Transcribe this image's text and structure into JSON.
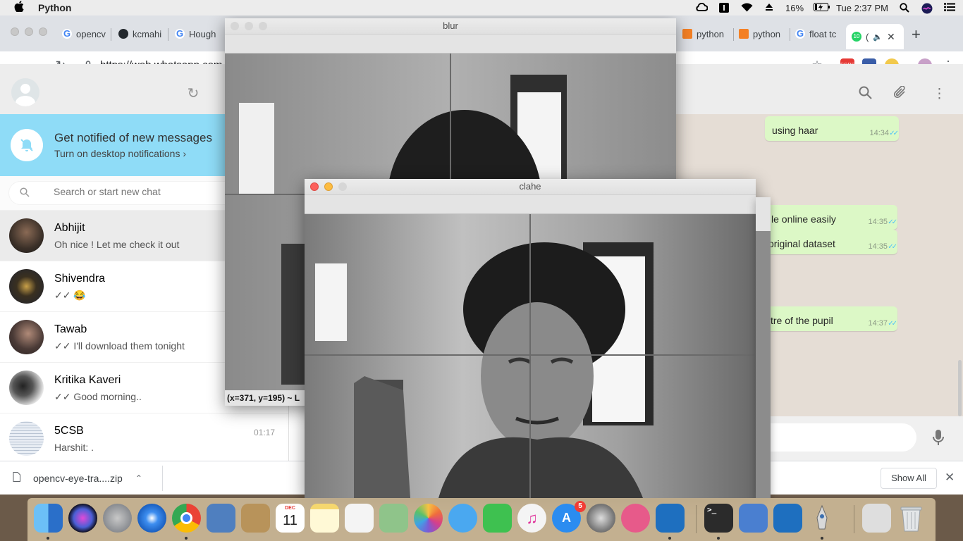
{
  "menubar": {
    "apple": "",
    "app_name": "Python",
    "battery": "16%",
    "clock": "Tue 2:37 PM"
  },
  "tabs": [
    {
      "label": "opencv",
      "icon": "google-icon",
      "color": "#4285f4"
    },
    {
      "label": "kcmahi",
      "icon": "github-icon",
      "color": "#24292e"
    },
    {
      "label": "Hough",
      "icon": "google-icon",
      "color": "#4285f4"
    },
    {
      "label": "python",
      "icon": "stackoverflow-icon",
      "color": "#f48024"
    },
    {
      "label": "python",
      "icon": "stackoverflow-icon",
      "color": "#f48024"
    },
    {
      "label": "float tc",
      "icon": "google-icon",
      "color": "#4285f4"
    },
    {
      "label": "(",
      "icon": "whatsapp-icon",
      "color": "#25d366"
    }
  ],
  "active_tab_favicon_text": "10",
  "url": "https://web.whatsapp.com",
  "extensions": [
    {
      "label": "CORS",
      "color": "#e53935"
    },
    {
      "label": "",
      "color": "#3a5da8"
    },
    {
      "label": "",
      "color": "#f2c94c"
    },
    {
      "label": "",
      "color": "#c8a0c8"
    }
  ],
  "notification": {
    "title": "Get notified of new messages",
    "subtitle": "Turn on desktop notifications ›"
  },
  "search": {
    "placeholder": "Search or start new chat"
  },
  "chats": [
    {
      "name": "Abhijit",
      "message": "Oh nice ! Let me check it out",
      "time": "",
      "color": "#3b3028"
    },
    {
      "name": "Shivendra",
      "message": "✓✓ 😂",
      "time": "",
      "color": "#1f2330"
    },
    {
      "name": "Tawab",
      "message": "✓✓ I'll download them tonight",
      "time": "",
      "color": "#4a3a36"
    },
    {
      "name": "Kritika Kaveri",
      "message": "✓✓ Good morning..",
      "time": "",
      "color": "#d9d9d9"
    },
    {
      "name": "5CSB",
      "message": "Harshit: .",
      "time": "01:17",
      "color": "#e8edf4"
    }
  ],
  "messages": [
    {
      "text": "using haar",
      "time": "14:34"
    },
    {
      "text": "le online easily",
      "time": "14:35"
    },
    {
      "text": "original dataset",
      "time": "14:35"
    },
    {
      "text": "tre of the pupil",
      "time": "14:37"
    }
  ],
  "download": {
    "filename": "opencv-eye-tra....zip",
    "show_all": "Show All"
  },
  "cv_blur": {
    "title": "blur",
    "status": "(x=371, y=195) ~ L"
  },
  "cv_clahe": {
    "title": "clahe"
  },
  "dock": [
    {
      "name": "finder",
      "color": "#3a8ee6"
    },
    {
      "name": "siri",
      "color": "#2b2b50"
    },
    {
      "name": "launchpad",
      "color": "#8a8f98"
    },
    {
      "name": "safari",
      "color": "#2a7be4"
    },
    {
      "name": "chrome",
      "color": "#e8e8e8"
    },
    {
      "name": "preview",
      "color": "#4f7fbf"
    },
    {
      "name": "contacts",
      "color": "#b8935a"
    },
    {
      "name": "calendar",
      "color": "#ffffff"
    },
    {
      "name": "notes",
      "color": "#f5d76e"
    },
    {
      "name": "reminders",
      "color": "#f4f4f4"
    },
    {
      "name": "maps",
      "color": "#8fc48a"
    },
    {
      "name": "photos",
      "color": "#ffffff"
    },
    {
      "name": "messages",
      "color": "#4aa8f0"
    },
    {
      "name": "facetime",
      "color": "#3ec150"
    },
    {
      "name": "itunes",
      "color": "#f4f4f4"
    },
    {
      "name": "app-store",
      "color": "#2b8cf0"
    },
    {
      "name": "system-preferences",
      "color": "#7d7d7d"
    },
    {
      "name": "archive-utility",
      "color": "#e75a8a"
    },
    {
      "name": "vscode",
      "color": "#1e6fbf"
    },
    {
      "name": "terminal",
      "color": "#2b2b2b"
    },
    {
      "name": "keynote",
      "color": "#4a7fd0"
    },
    {
      "name": "vscode-2",
      "color": "#1e6fbf"
    },
    {
      "name": "python-launcher",
      "color": "#6b6b6b"
    },
    {
      "name": "documents",
      "color": "#dedede"
    },
    {
      "name": "trash",
      "color": "#cfd3d6"
    }
  ],
  "calendar": {
    "month": "DEC",
    "day": "11"
  },
  "app_store_badge": "5"
}
